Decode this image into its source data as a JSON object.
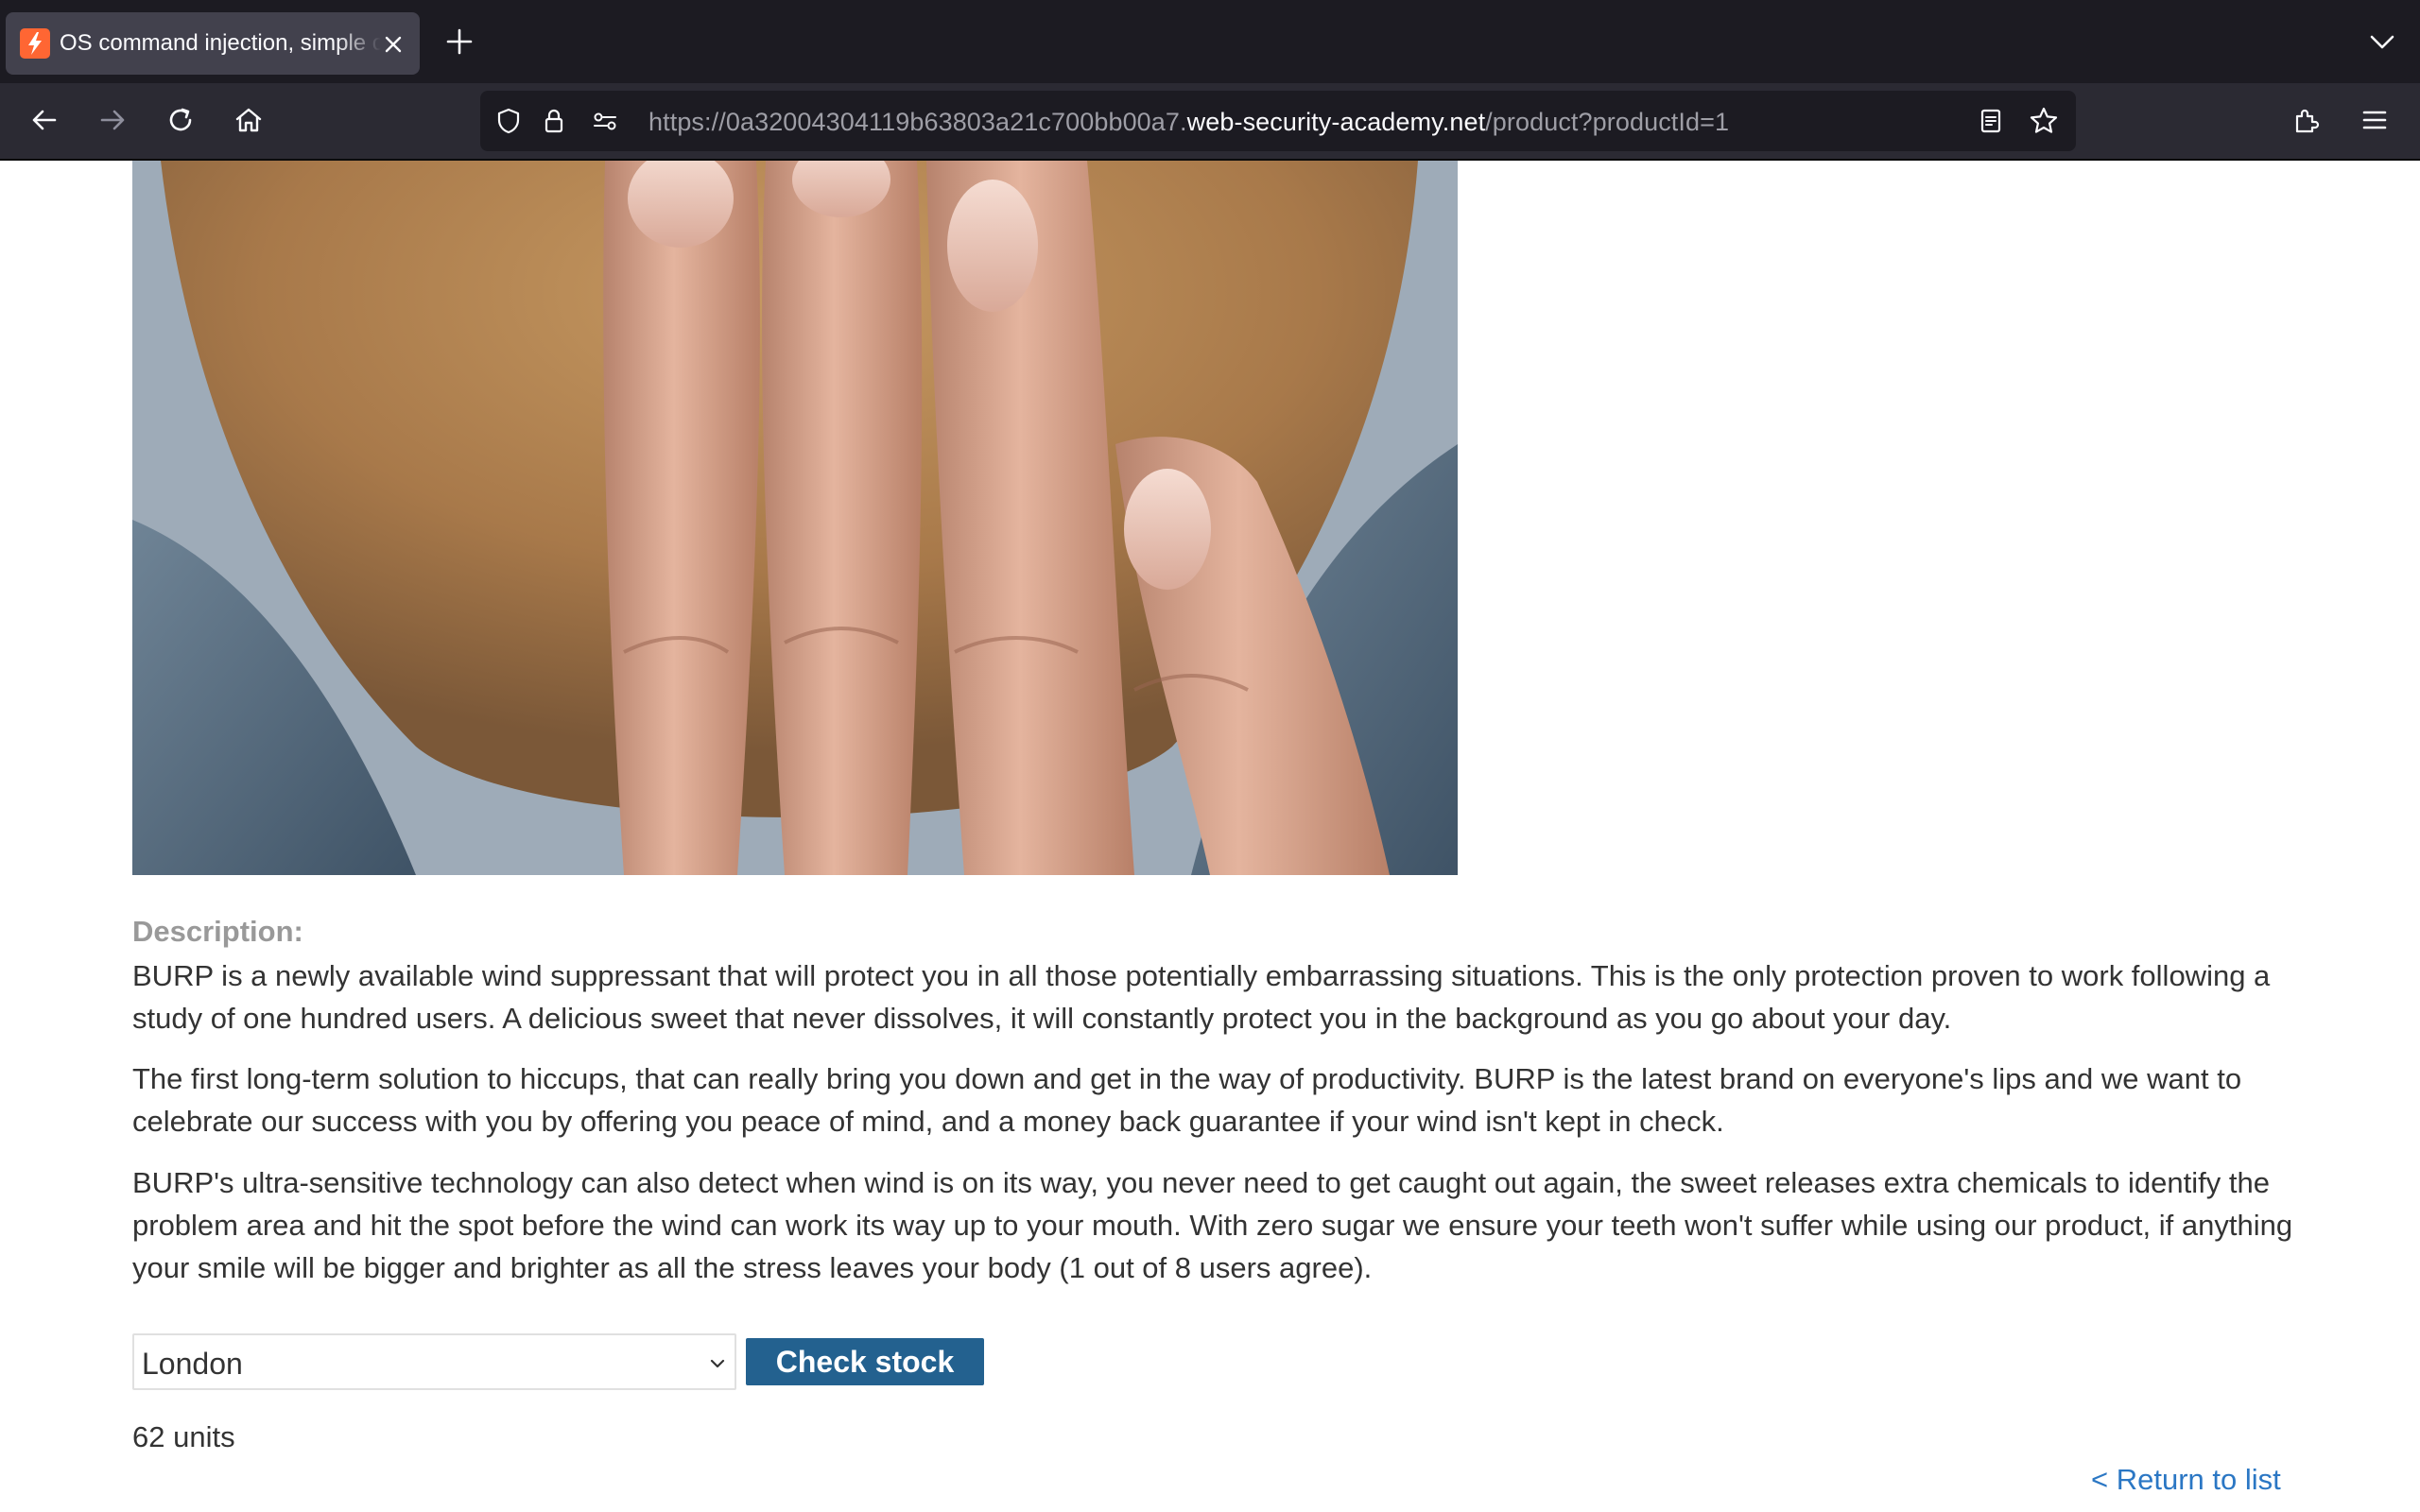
{
  "browser": {
    "tab_title": "OS command injection, simple case",
    "url_prefix": "https://0a32004304119b63803a21c700bb00a7.",
    "url_host": "web-security-academy.net",
    "url_path": "/product?productId=1"
  },
  "product": {
    "description_label": "Description:",
    "paragraphs": [
      "BURP is a newly available wind suppressant that will protect you in all those potentially embarrassing situations. This is the only protection proven to work following a study of one hundred users. A delicious sweet that never dissolves, it will constantly protect you in the background as you go about your day.",
      "The first long-term solution to hiccups, that can really bring you down and get in the way of productivity. BURP is the latest brand on everyone's lips and we want to celebrate our success with you by offering you peace of mind, and a money back guarantee if your wind isn't kept in check.",
      "BURP's ultra-sensitive technology can also detect when wind is on its way, you never need to get caught out again, the sweet releases extra chemicals to identify the problem area and hit the spot before the wind can work its way up to your mouth. With zero sugar we ensure your teeth won't suffer while using our product, if anything your smile will be bigger and brighter as all the stress leaves your body (1 out of 8 users agree)."
    ]
  },
  "stock_check": {
    "selected_store": "London",
    "button_label": "Check stock",
    "result": "62 units"
  },
  "return_link": "< Return to list"
}
